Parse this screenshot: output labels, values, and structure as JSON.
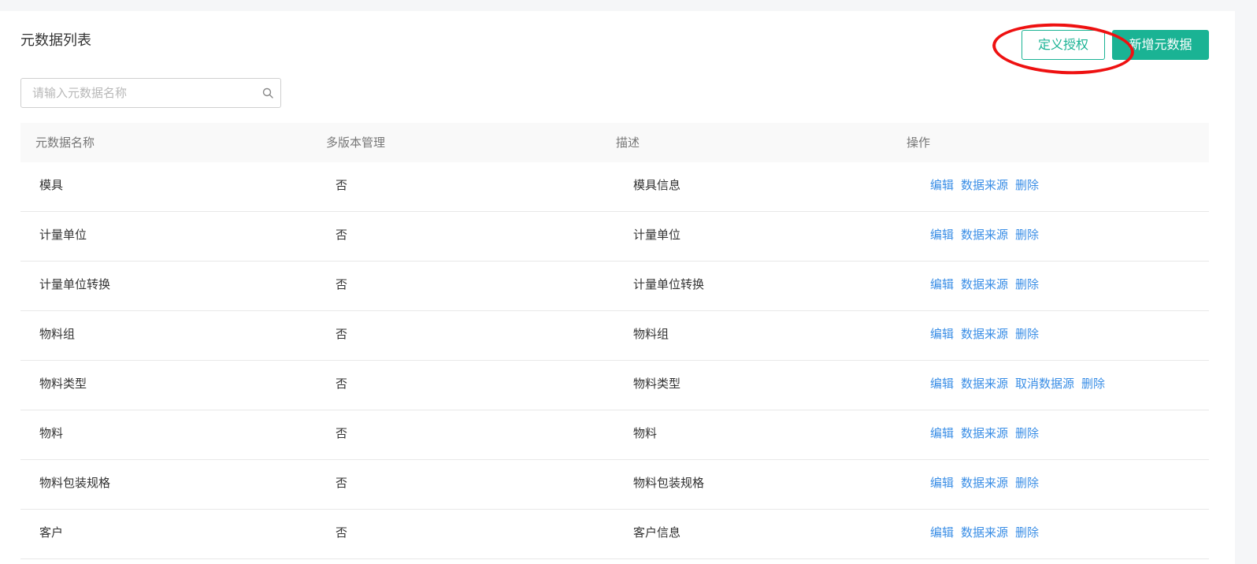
{
  "page": {
    "title": "元数据列表",
    "authorize_label": "定义授权",
    "add_label": "新增元数据",
    "accent_color": "#1ab394",
    "link_color": "#3a8ee6",
    "annotation_color": "#ee1111"
  },
  "search": {
    "placeholder": "请输入元数据名称",
    "icon": "search-icon"
  },
  "table": {
    "columns": [
      "元数据名称",
      "多版本管理",
      "描述",
      "操作"
    ],
    "rows": [
      {
        "name": "模具",
        "versioned": "否",
        "description": "模具信息",
        "actions": [
          "编辑",
          "数据来源",
          "删除"
        ]
      },
      {
        "name": "计量单位",
        "versioned": "否",
        "description": "计量单位",
        "actions": [
          "编辑",
          "数据来源",
          "删除"
        ]
      },
      {
        "name": "计量单位转换",
        "versioned": "否",
        "description": "计量单位转换",
        "actions": [
          "编辑",
          "数据来源",
          "删除"
        ]
      },
      {
        "name": "物料组",
        "versioned": "否",
        "description": "物料组",
        "actions": [
          "编辑",
          "数据来源",
          "删除"
        ]
      },
      {
        "name": "物料类型",
        "versioned": "否",
        "description": "物料类型",
        "actions": [
          "编辑",
          "数据来源",
          "取消数据源",
          "删除"
        ]
      },
      {
        "name": "物料",
        "versioned": "否",
        "description": "物料",
        "actions": [
          "编辑",
          "数据来源",
          "删除"
        ]
      },
      {
        "name": "物料包装规格",
        "versioned": "否",
        "description": "物料包装规格",
        "actions": [
          "编辑",
          "数据来源",
          "删除"
        ]
      },
      {
        "name": "客户",
        "versioned": "否",
        "description": "客户信息",
        "actions": [
          "编辑",
          "数据来源",
          "删除"
        ]
      }
    ]
  }
}
